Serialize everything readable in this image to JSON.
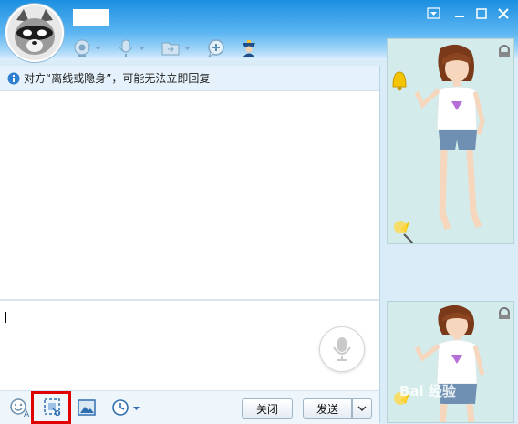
{
  "window": {
    "buttons": [
      "menu",
      "minimize",
      "maximize",
      "close"
    ]
  },
  "header": {
    "avatar_icon": "raccoon-avatar-icon",
    "toolbar_icons": [
      "video-call-icon",
      "voice-call-icon",
      "file-transfer-icon",
      "add-app-icon",
      "remote-assist-icon"
    ]
  },
  "notice": {
    "icon": "info-icon",
    "text": "对方“离线或隐身”，可能无法立即回复"
  },
  "input": {
    "value": ""
  },
  "bottom_toolbar": {
    "icons": [
      "font-emoji-icon",
      "screenshot-icon",
      "image-icon",
      "history-clock-icon"
    ],
    "close_label": "关闭",
    "send_label": "发送"
  },
  "side_panel": {
    "top_icon": "show-settings-icon",
    "bell_icon": "bell-icon",
    "magic_icon": "magic-wand-icon"
  },
  "watermark": {
    "text": "Bai 经验"
  },
  "colors": {
    "title_gradient_top": "#1b8fe0",
    "highlight": "#e00000",
    "panel_bg": "#d3ebea"
  }
}
